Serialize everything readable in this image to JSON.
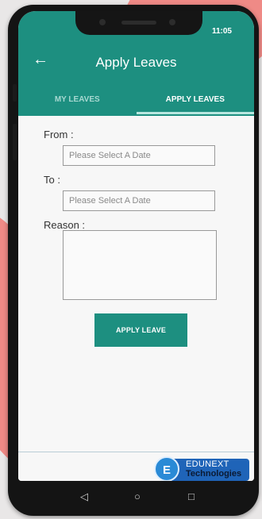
{
  "status_bar": {
    "time": "11:05"
  },
  "app_bar": {
    "back_icon": "arrow-left-icon",
    "title": "Apply Leaves"
  },
  "tabs": [
    {
      "label": "MY LEAVES",
      "active": false
    },
    {
      "label": "APPLY LEAVES",
      "active": true
    }
  ],
  "form": {
    "from_label": "From :",
    "from_placeholder": "Please Select A Date",
    "to_label": "To :",
    "to_placeholder": "Please Select A Date",
    "reason_label": "Reason :",
    "reason_value": "",
    "submit_label": "APPLY LEAVE"
  },
  "branding": {
    "line1": "EDUNEXT",
    "line2": "Technologies",
    "icon_letter": "E"
  },
  "nav_bar": {
    "back": "◁",
    "home": "○",
    "recents": "□"
  },
  "colors": {
    "primary": "#1d8f80",
    "accent_bg": "#ef8a86",
    "brand_blue": "#1f64b8"
  }
}
